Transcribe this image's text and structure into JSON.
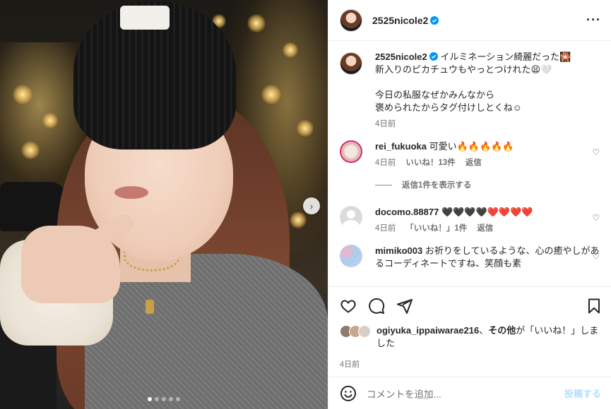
{
  "post": {
    "username": "2525nicole2",
    "verified": true,
    "more_icon": "more-horizontal-icon"
  },
  "caption": {
    "username": "2525nicole2",
    "text": "イルミネーション綺麗だった🎇\n新入りのピカチュウもやっとつけれた😫🤍\n\n今日の私服なぜかみんなから\n褒められたからタグ付けしとくね☺︎",
    "time": "4日前"
  },
  "comments": [
    {
      "username": "rei_fukuoka",
      "text": "可愛い🔥🔥🔥🔥🔥",
      "time": "4日前",
      "likes": "いいね！13件",
      "reply": "返信",
      "view_replies": "返信1件を表示する"
    },
    {
      "username": "docomo.88877",
      "text": "🖤🖤🖤🖤❤️❤️❤️❤️",
      "time": "4日前",
      "likes": "「いいね！」1件",
      "reply": "返信"
    },
    {
      "username": "mimiko003",
      "text": "お祈りをしているような、心の癒やしがあるコーディネートですね、笑顔も素"
    }
  ],
  "likes_line": {
    "user": "ogiyuka_ippaiwarae216",
    "sep": "、",
    "others": "その他",
    "suffix": "が「いいね！」しました"
  },
  "post_time": "4日前",
  "composer": {
    "placeholder": "コメントを追加...",
    "post_label": "投稿する"
  },
  "carousel": {
    "total": 5,
    "current": 1
  },
  "colors": {
    "accent": "#0095f6",
    "post_disabled": "#b2dffc",
    "muted": "#737373"
  }
}
